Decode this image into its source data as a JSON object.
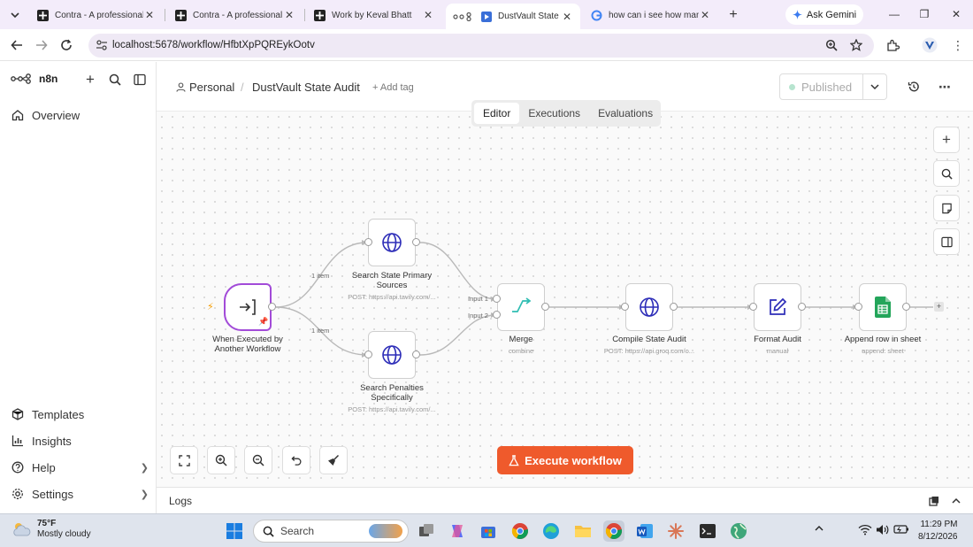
{
  "browser": {
    "tabs": [
      {
        "title": "Contra - A professional",
        "active": false
      },
      {
        "title": "Contra - A professional",
        "active": false
      },
      {
        "title": "Work by Keval Bhatt",
        "active": false
      },
      {
        "title": "DustVault State Audi",
        "active": true
      },
      {
        "title": "how can i see how man",
        "active": false
      }
    ],
    "gemini_label": "Ask Gemini",
    "url": "localhost:5678/workflow/HfbtXpPQREykOotv"
  },
  "sidebar": {
    "brand": "n8n",
    "items": [
      {
        "label": "Overview",
        "icon": "home-icon"
      },
      {
        "label": "Templates",
        "icon": "templates-icon"
      },
      {
        "label": "Insights",
        "icon": "insights-icon"
      },
      {
        "label": "Help",
        "icon": "help-icon"
      },
      {
        "label": "Settings",
        "icon": "settings-icon"
      }
    ]
  },
  "header": {
    "project": "Personal",
    "workflow_name": "DustVault State Audit",
    "add_tag": "+ Add tag",
    "status": "Published"
  },
  "view_tabs": [
    "Editor",
    "Executions",
    "Evaluations"
  ],
  "canvas": {
    "nodes": [
      {
        "name": "When Executed by Another Workflow",
        "subtitle": "",
        "icon": "execute-workflow-trigger-icon"
      },
      {
        "name": "Search State Primary Sources",
        "subtitle": "POST: https://api.tavily.com/...",
        "icon": "globe-icon"
      },
      {
        "name": "Search Penalties Specifically",
        "subtitle": "POST: https://api.tavily.com/...",
        "icon": "globe-icon"
      },
      {
        "name": "Merge",
        "subtitle": "combine",
        "icon": "merge-icon"
      },
      {
        "name": "Compile State Audit",
        "subtitle": "POST: https://api.groq.com/o...",
        "icon": "globe-icon"
      },
      {
        "name": "Format Audit",
        "subtitle": "manual",
        "icon": "edit-icon"
      },
      {
        "name": "Append row in sheet",
        "subtitle": "append: sheet",
        "icon": "google-sheets-icon"
      }
    ],
    "edge_labels": {
      "item_top": "1 item",
      "item_bottom": "1 item",
      "input1": "Input 1",
      "input2": "Input 2"
    },
    "execute_label": "Execute workflow"
  },
  "logs_label": "Logs",
  "taskbar": {
    "temp": "75°F",
    "condition": "Mostly cloudy",
    "search_placeholder": "Search",
    "time": "11:29 PM",
    "date": "8/12/2026"
  }
}
